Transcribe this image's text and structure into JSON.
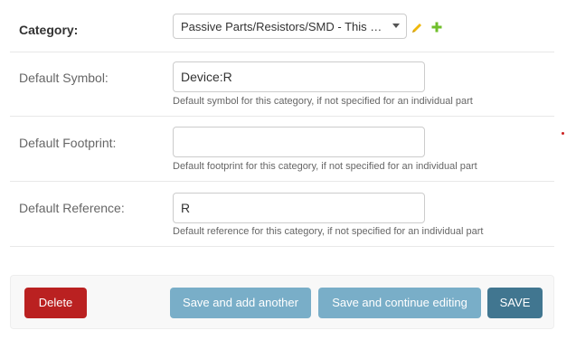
{
  "form": {
    "category": {
      "label": "Category:",
      "selected": "Passive Parts/Resistors/SMD - This are small resistors",
      "edit_icon": "pencil-icon",
      "add_icon": "plus-icon"
    },
    "symbol": {
      "label": "Default Symbol:",
      "value": "Device:R",
      "help": "Default symbol for this category, if not specified for an individual part"
    },
    "footprint": {
      "label": "Default Footprint:",
      "value": "",
      "help": "Default footprint for this category, if not specified for an individual part"
    },
    "reference": {
      "label": "Default Reference:",
      "value": "R",
      "help": "Default reference for this category, if not specified for an individual part"
    }
  },
  "actions": {
    "delete": "Delete",
    "save_add_another": "Save and add another",
    "save_continue": "Save and continue editing",
    "save": "SAVE"
  },
  "colors": {
    "delete": "#ba2121",
    "secondary": "#79aec8",
    "primary": "#417690",
    "edit_icon": "#efb80b",
    "add_icon": "#70bf2b"
  }
}
